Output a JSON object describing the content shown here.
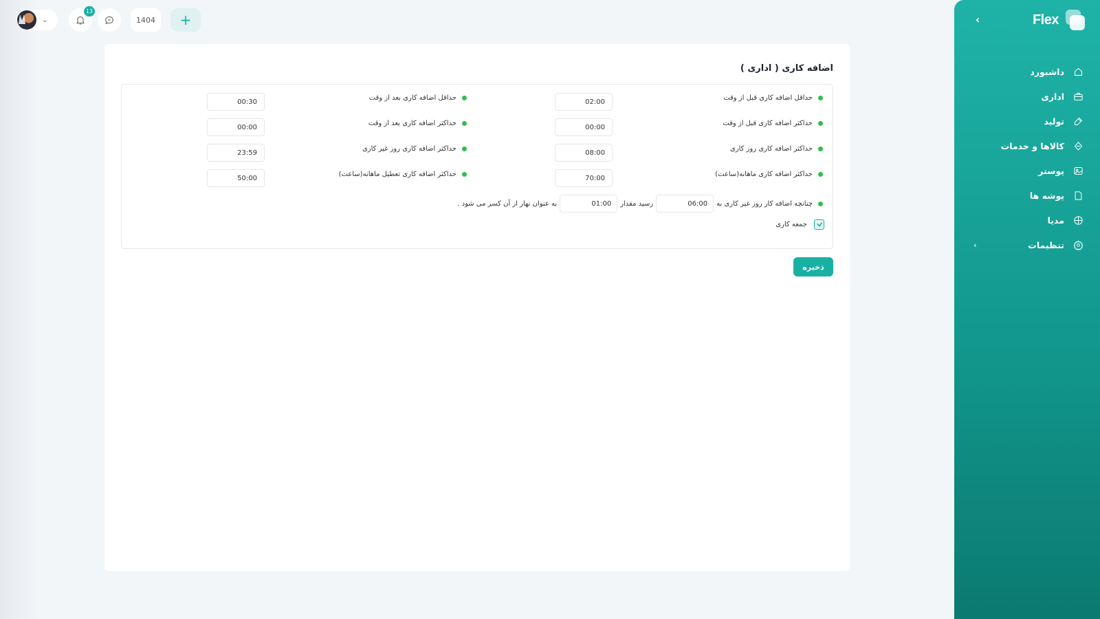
{
  "topbar": {
    "notification_count": "13",
    "year": "1404",
    "add_symbol": "+"
  },
  "sidebar": {
    "brand": "Flex",
    "collapse_symbol": "‹",
    "items": [
      {
        "label": "داشبورد",
        "icon": "home-icon"
      },
      {
        "label": "اداری",
        "icon": "briefcase-icon"
      },
      {
        "label": "تولید",
        "icon": "tools-icon"
      },
      {
        "label": "کالاها و خدمات",
        "icon": "cube-icon"
      },
      {
        "label": "پوستر",
        "icon": "image-icon"
      },
      {
        "label": "پوشه ها",
        "icon": "folder-icon"
      },
      {
        "label": "مدیا",
        "icon": "globe-icon"
      },
      {
        "label": "تنظیمات",
        "icon": "gear-icon",
        "has_children": true
      }
    ]
  },
  "page": {
    "title": "اضافه کاری ( اداری )",
    "save_label": "ذخیره"
  },
  "fields_right": [
    {
      "label": "حداقل اضافه کاری قبل از وقت",
      "value": "02:00"
    },
    {
      "label": "حداکثر اضافه کاری قبل از وقت",
      "value": "00:00"
    },
    {
      "label": "حداکثر اضافه کاری روز کاری",
      "value": "08:00"
    },
    {
      "label": "حداکثر اضافه کاری ماهانه(ساعت)",
      "value": "70:00"
    }
  ],
  "fields_left": [
    {
      "label": "حداقل اضافه کاری بعد از وقت",
      "value": "00:30"
    },
    {
      "label": "حداکثر اضافه کاری بعد از وقت",
      "value": "00:00"
    },
    {
      "label": "حداکثر اضافه کاری روز غیر کاری",
      "value": "23:59"
    },
    {
      "label": "حداکثر اضافه کاری تعطیل ماهانه(ساعت)",
      "value": "50:00"
    }
  ],
  "lunch_rule": {
    "text_1": "چنانچه اضافه کار روز غیر کاری به",
    "value_1": "06:00",
    "text_2": "رسید مقدار",
    "value_2": "01:00",
    "text_3": "به عنوان نهار از آن کسر می شود ."
  },
  "friday": {
    "label": "جمعه کاری",
    "checked": true
  },
  "colors": {
    "accent": "#19b0a4",
    "dot": "#2fbf4f"
  }
}
